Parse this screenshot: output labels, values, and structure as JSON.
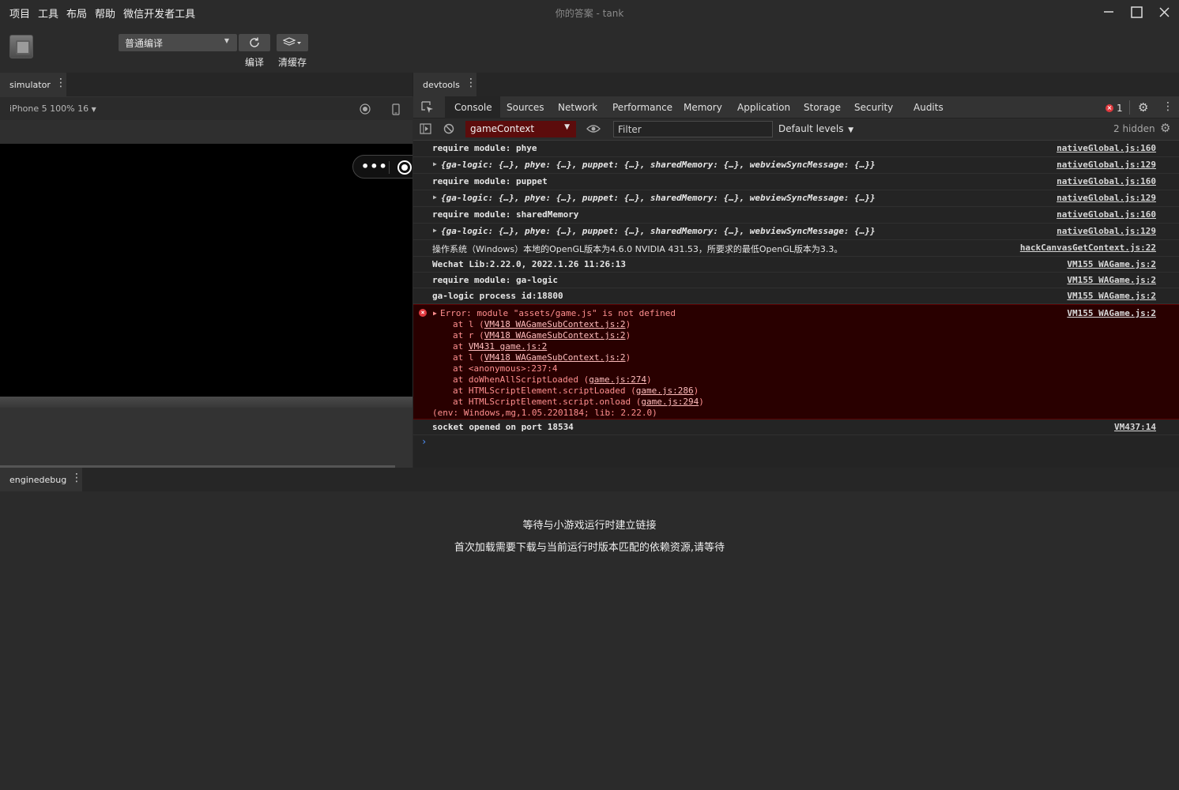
{
  "menu": [
    "项目",
    "工具",
    "布局",
    "帮助",
    "微信开发者工具"
  ],
  "window": {
    "title": "你的答案 - tank"
  },
  "toolbar": {
    "compile_mode": "普通编译",
    "compile_label": "编译",
    "clear_cache_label": "清缓存"
  },
  "simulator": {
    "tab_label": "simulator",
    "device_label": "iPhone 5 100% 16"
  },
  "devtools": {
    "tab_label": "devtools",
    "tabs": [
      "Console",
      "Sources",
      "Network",
      "Performance",
      "Memory",
      "Application",
      "Storage",
      "Security",
      "Audits"
    ],
    "error_count": "1",
    "context": "gameContext",
    "filter_placeholder": "Filter",
    "levels": "Default levels",
    "hidden_count": "2 hidden",
    "logs": [
      {
        "msg": "require module: phye",
        "src": "nativeGlobal.js:160"
      },
      {
        "msg": "{ga-logic: {…}, phye: {…}, puppet: {…}, sharedMemory: {…}, webviewSyncMessage: {…}}",
        "src": "nativeGlobal.js:129"
      },
      {
        "msg": "require module: puppet",
        "src": "nativeGlobal.js:160"
      },
      {
        "msg": "{ga-logic: {…}, phye: {…}, puppet: {…}, sharedMemory: {…}, webviewSyncMessage: {…}}",
        "src": "nativeGlobal.js:129"
      },
      {
        "msg": "require module: sharedMemory",
        "src": "nativeGlobal.js:160"
      },
      {
        "msg": "{ga-logic: {…}, phye: {…}, puppet: {…}, sharedMemory: {…}, webviewSyncMessage: {…}}",
        "src": "nativeGlobal.js:129"
      },
      {
        "msg": "操作系统（Windows）本地的OpenGL版本为4.6.0 NVIDIA 431.53，所要求的最低OpenGL版本为3.3。",
        "src": "hackCanvasGetContext.js:22"
      },
      {
        "msg": "Wechat Lib:2.22.0, 2022.1.26 11:26:13",
        "src": "VM155 WAGame.js:2"
      },
      {
        "msg": "require module: ga-logic",
        "src": "VM155 WAGame.js:2"
      },
      {
        "msg": "ga-logic process id:18800",
        "src": "VM155 WAGame.js:2"
      }
    ],
    "error": {
      "head": "Error: module \"assets/game.js\" is not defined",
      "src": "VM155 WAGame.js:2",
      "stack": [
        {
          "pre": "at l (",
          "link": "VM418 WAGameSubContext.js:2",
          "post": ")"
        },
        {
          "pre": "at r (",
          "link": "VM418 WAGameSubContext.js:2",
          "post": ")"
        },
        {
          "pre": "at ",
          "link": "VM431 game.js:2",
          "post": ""
        },
        {
          "pre": "at l (",
          "link": "VM418 WAGameSubContext.js:2",
          "post": ")"
        },
        {
          "pre": "at <anonymous>:237:4",
          "link": "",
          "post": ""
        },
        {
          "pre": "at doWhenAllScriptLoaded (",
          "link": "game.js:274",
          "post": ")"
        },
        {
          "pre": "at HTMLScriptElement.scriptLoaded (",
          "link": "game.js:286",
          "post": ")"
        },
        {
          "pre": "at HTMLScriptElement.script.onload (",
          "link": "game.js:294",
          "post": ")"
        }
      ],
      "env": "(env: Windows,mg,1.05.2201184; lib: 2.22.0)"
    },
    "last_log": {
      "msg": "socket opened on port 18534",
      "src": "VM437:14"
    },
    "prompt": "›"
  },
  "enginedebug": {
    "tab_label": "enginedebug",
    "message1": "等待与小游戏运行时建立链接",
    "message2": "首次加载需要下载与当前运行时版本匹配的依赖资源,请等待"
  }
}
